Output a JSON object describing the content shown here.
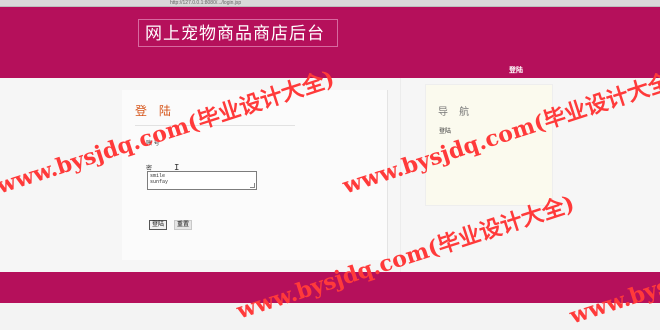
{
  "browser": {
    "url": "http://127.0.0.1:8080/.../login.jsp"
  },
  "header": {
    "title": "网上宠物商品商店后台",
    "nav_link": "登陆"
  },
  "login": {
    "title": "登 陆",
    "account_label": "账 号",
    "password_label": "密",
    "cursor": "I",
    "autocomplete_values": [
      "smile",
      "sunfay"
    ],
    "login_button": "登陆",
    "reset_button": "重置"
  },
  "nav": {
    "title": "导 航",
    "link": "登陆"
  },
  "watermark": {
    "text": "www.bysjdq.com(毕业设计大全)"
  }
}
